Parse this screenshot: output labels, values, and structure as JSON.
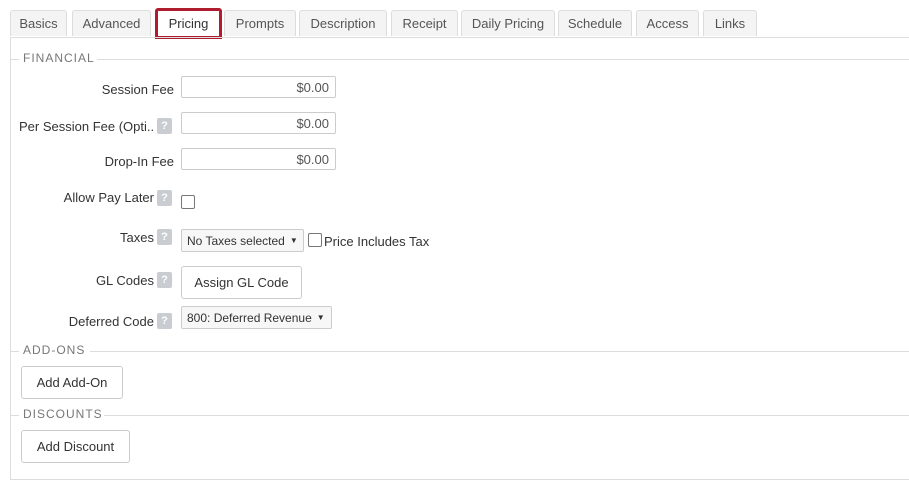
{
  "tabs": [
    {
      "label": "Basics"
    },
    {
      "label": "Advanced"
    },
    {
      "label": "Pricing"
    },
    {
      "label": "Prompts"
    },
    {
      "label": "Description"
    },
    {
      "label": "Receipt"
    },
    {
      "label": "Daily Pricing"
    },
    {
      "label": "Schedule"
    },
    {
      "label": "Access"
    },
    {
      "label": "Links"
    }
  ],
  "active_tab": "Pricing",
  "financial": {
    "legend": "FINANCIAL",
    "session_fee": {
      "label": "Session Fee",
      "value": "$0.00"
    },
    "per_session_fee": {
      "label": "Per Session Fee (Opti...",
      "value": "$0.00"
    },
    "drop_in_fee": {
      "label": "Drop-In Fee",
      "value": "$0.00"
    },
    "allow_pay_later": {
      "label": "Allow Pay Later",
      "checked": false
    },
    "taxes": {
      "label": "Taxes",
      "selected": "No Taxes selected",
      "price_includes_tax_label": "Price Includes Tax",
      "price_includes_tax_checked": false
    },
    "gl_codes": {
      "label": "GL Codes",
      "button": "Assign GL Code"
    },
    "deferred_code": {
      "label": "Deferred Code",
      "selected": "800: Deferred Revenue"
    },
    "help_glyph": "?"
  },
  "addons": {
    "legend": "ADD-ONS",
    "button": "Add Add-On"
  },
  "discounts": {
    "legend": "DISCOUNTS",
    "button": "Add Discount"
  },
  "colors": {
    "active_tab_border": "#b01d2e",
    "help_badge": "#c9ccd1"
  }
}
